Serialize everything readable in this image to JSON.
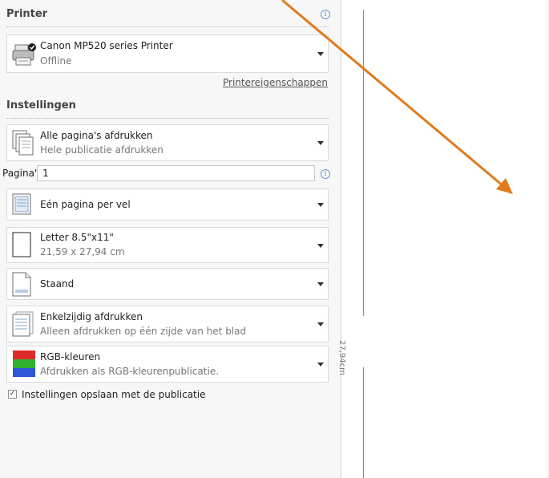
{
  "printer": {
    "heading": "Printer",
    "name": "Canon MP520 series Printer",
    "status": "Offline",
    "properties_link": "Printereigenschappen"
  },
  "settings": {
    "heading": "Instellingen",
    "print_range": {
      "title": "Alle pagina's afdrukken",
      "subtitle": "Hele publicatie afdrukken"
    },
    "pages": {
      "label": "Pagina's:",
      "value": "1"
    },
    "layout": {
      "title": "Eén pagina per vel"
    },
    "paper": {
      "title": "Letter 8.5\"x11\"",
      "subtitle": "21,59 x 27,94 cm"
    },
    "orientation": {
      "title": "Staand"
    },
    "sides": {
      "title": "Enkelzijdig afdrukken",
      "subtitle": "Alleen afdrukken op één zijde van het blad"
    },
    "color": {
      "title": "RGB-kleuren",
      "subtitle": "Afdrukken als RGB-kleurenpublicatie."
    },
    "save_with_publication": {
      "label": "Instellingen opslaan met de publicatie",
      "checked": true
    }
  },
  "preview": {
    "ruler_label": "27,94cm"
  },
  "icons": {
    "printer": "printer-icon",
    "info": "info-icon",
    "pages_stack": "page-stack-icon",
    "one_per_sheet": "one-page-per-sheet-icon",
    "paper": "paper-size-icon",
    "portrait": "portrait-orientation-icon",
    "one_sided": "one-sided-icon",
    "rgb": "rgb-color-icon",
    "dropdown": "chevron-down-icon"
  },
  "colors": {
    "annotation_arrow": "#e07b1d",
    "link": "#555555"
  }
}
